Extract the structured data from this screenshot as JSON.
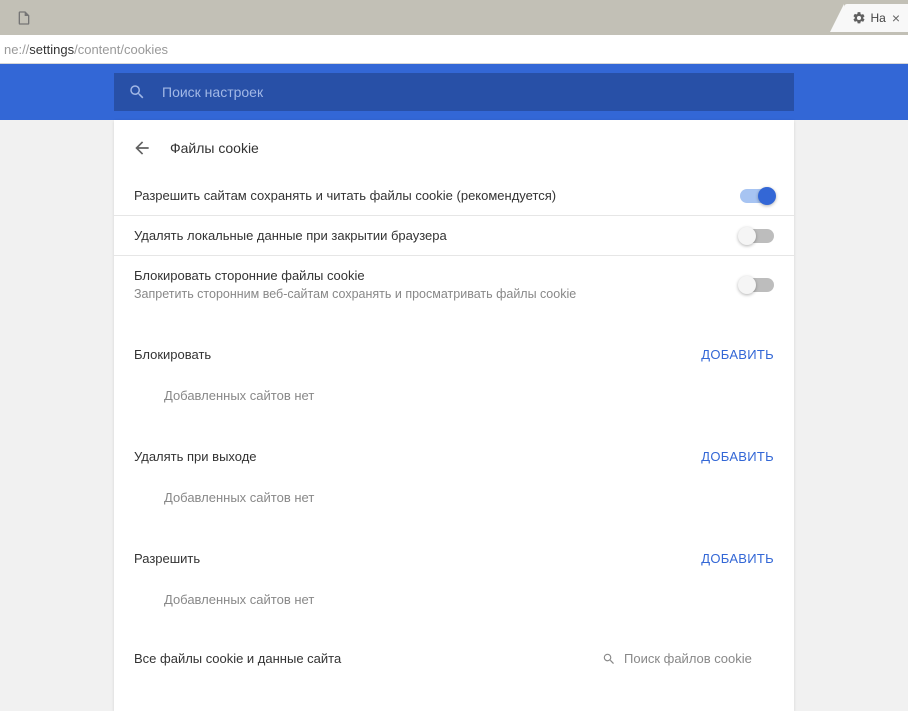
{
  "tab": {
    "title": "На",
    "close": "×"
  },
  "url": {
    "prefix": "ne://",
    "highlight": "settings",
    "suffix": "/content/cookies"
  },
  "search": {
    "placeholder": "Поиск настроек"
  },
  "page": {
    "title": "Файлы cookie"
  },
  "settings": {
    "allow": {
      "label": "Разрешить сайтам сохранять и читать файлы cookie (рекомендуется)",
      "enabled": true
    },
    "delete_on_close": {
      "label": "Удалять локальные данные при закрытии браузера",
      "enabled": false
    },
    "block_third_party": {
      "label": "Блокировать сторонние файлы cookie",
      "sublabel": "Запретить сторонним веб-сайтам сохранять и просматривать файлы cookie",
      "enabled": false
    }
  },
  "sections": {
    "block": {
      "title": "Блокировать",
      "add": "ДОБАВИТЬ",
      "empty": "Добавленных сайтов нет"
    },
    "delete_on_exit": {
      "title": "Удалять при выходе",
      "add": "ДОБАВИТЬ",
      "empty": "Добавленных сайтов нет"
    },
    "allow": {
      "title": "Разрешить",
      "add": "ДОБАВИТЬ",
      "empty": "Добавленных сайтов нет"
    }
  },
  "footer": {
    "title": "Все файлы cookie и данные сайта",
    "search_placeholder": "Поиск файлов cookie"
  }
}
